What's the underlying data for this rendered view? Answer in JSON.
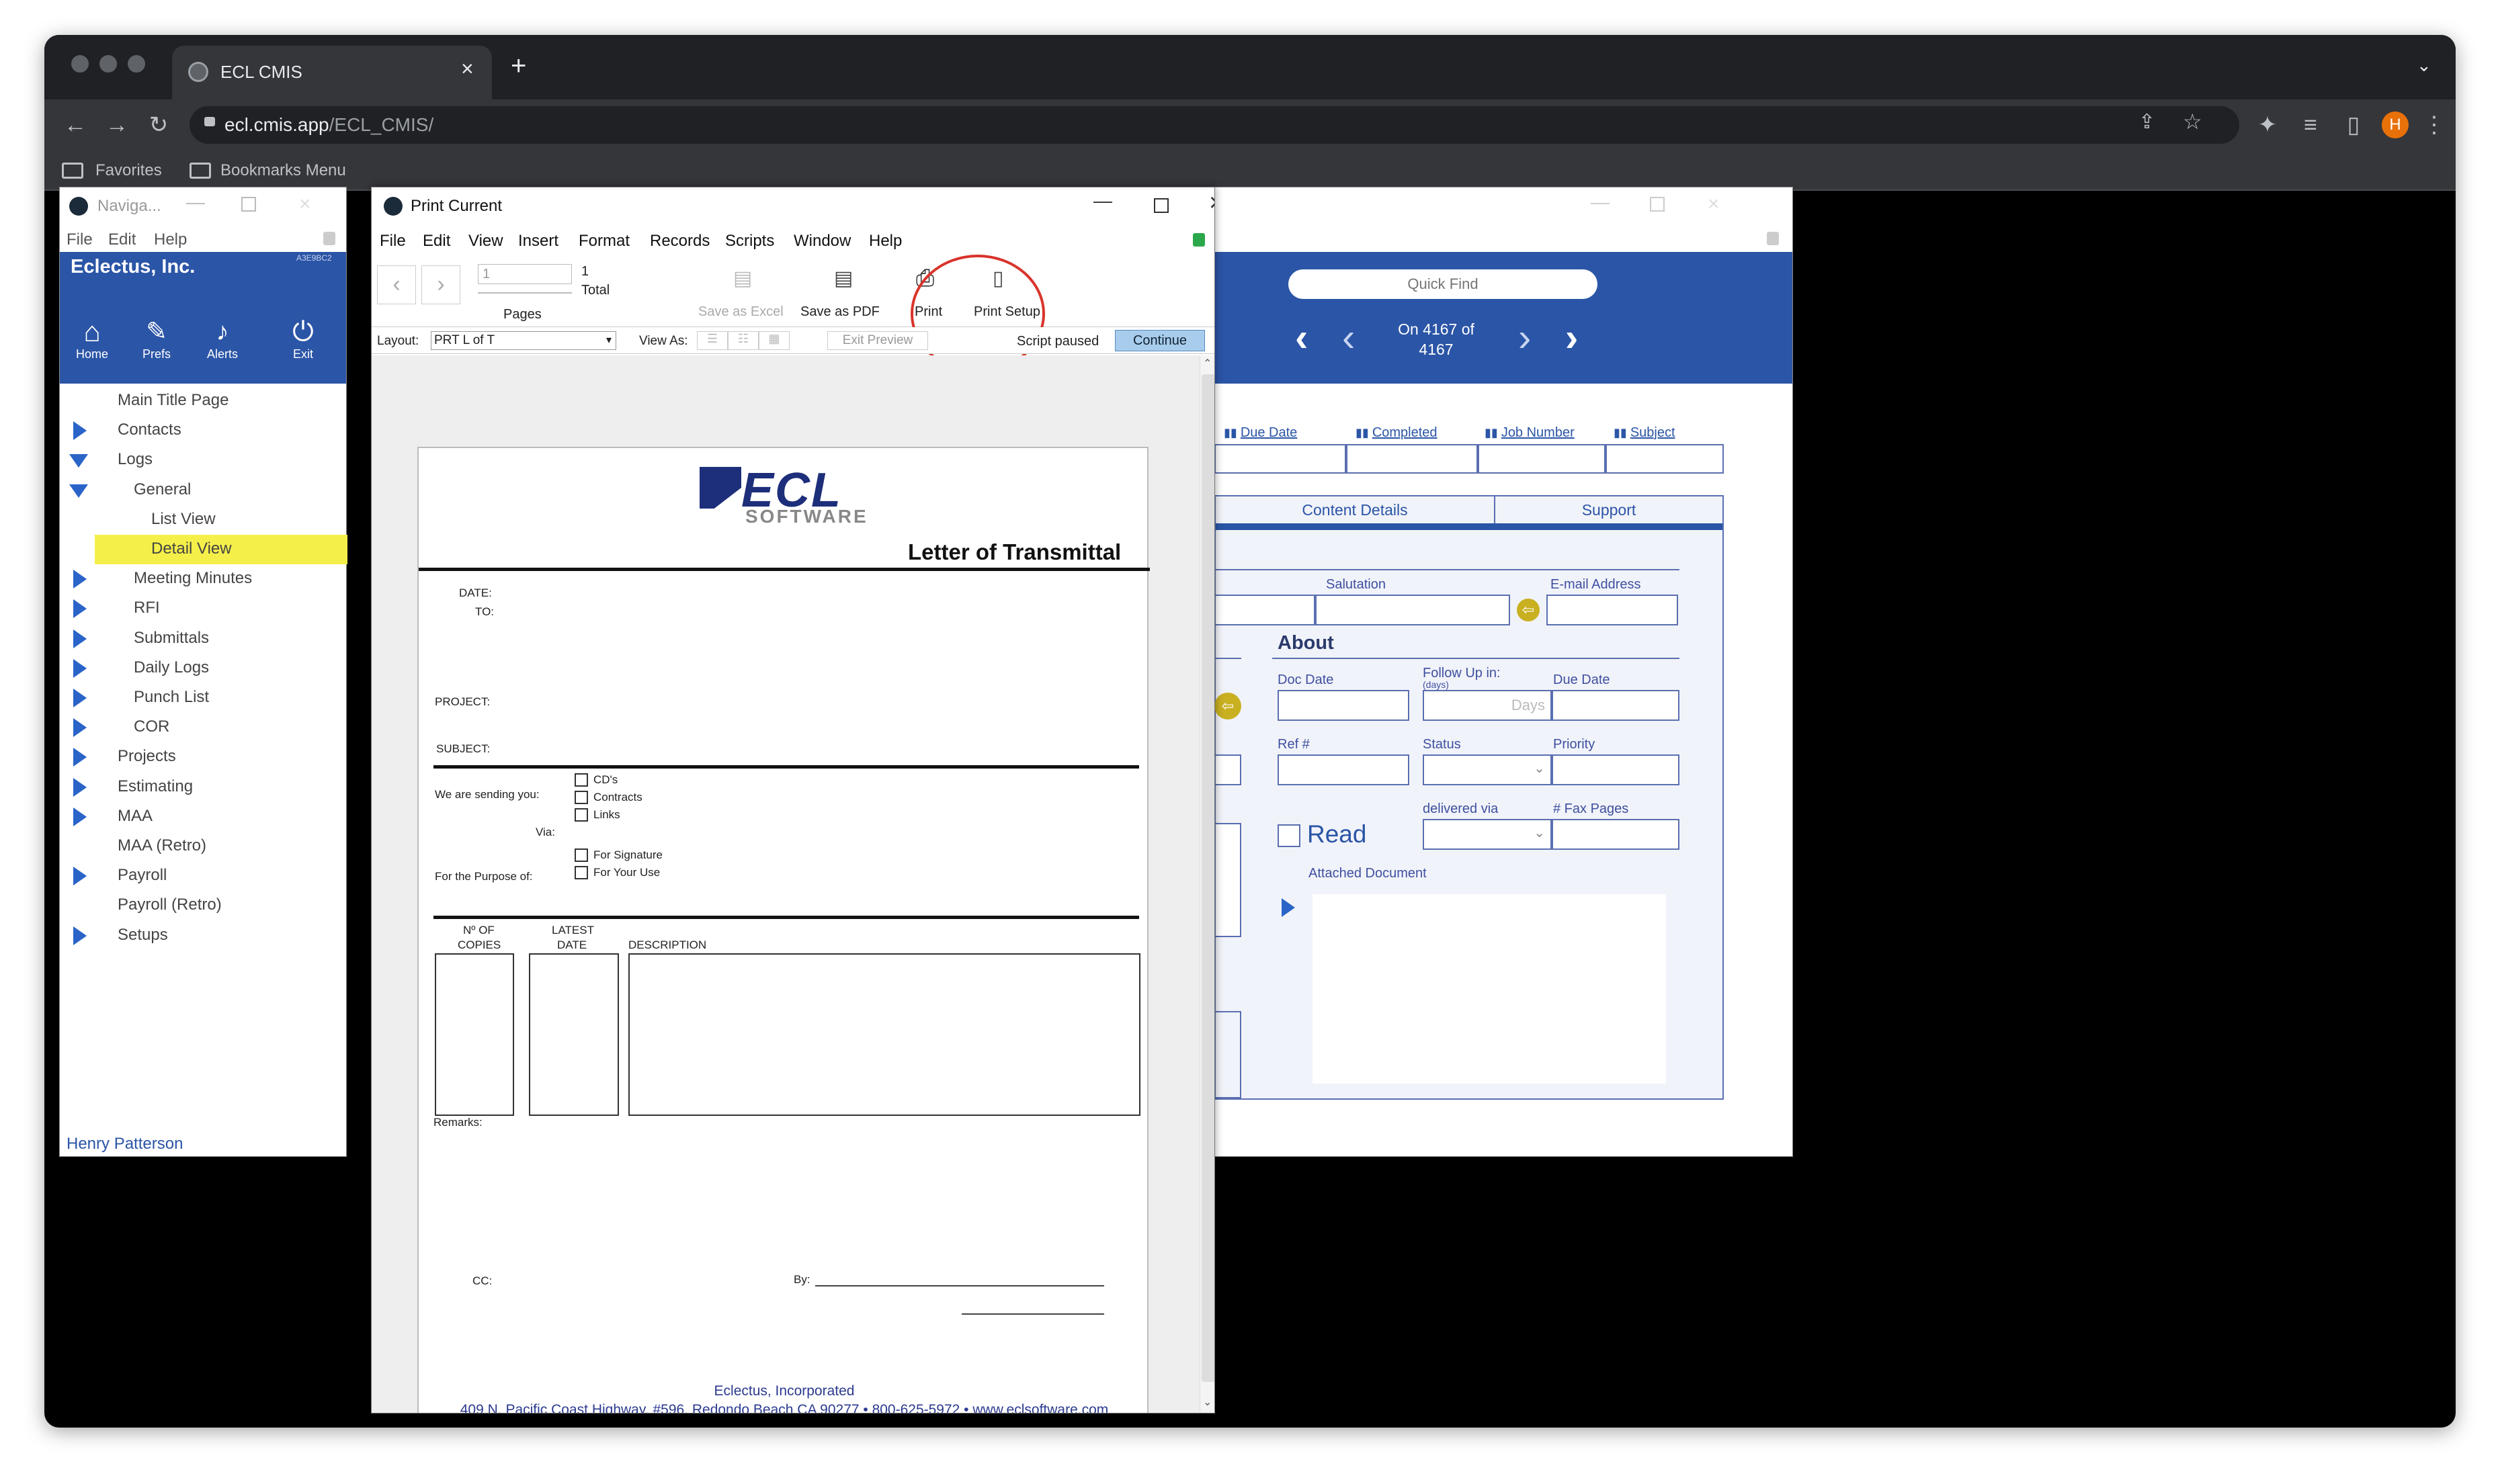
{
  "browser": {
    "tab_title": "ECL CMIS",
    "url_domain": "ecl.cmis.app",
    "url_path": "/ECL_CMIS/",
    "bookmarks": [
      "Favorites",
      "Bookmarks Menu"
    ],
    "profile_initial": "H"
  },
  "nav_window": {
    "title": "Naviga...",
    "menu": [
      "File",
      "Edit",
      "Help"
    ],
    "company": "Eclectus, Inc.",
    "code": "A3E9BC2",
    "toolbar": [
      {
        "label": "Home",
        "icon": "home-icon"
      },
      {
        "label": "Prefs",
        "icon": "prefs-icon"
      },
      {
        "label": "Alerts",
        "icon": "alerts-icon"
      },
      {
        "label": "Exit",
        "icon": "power-icon"
      }
    ],
    "items": [
      {
        "label": "Main Title Page",
        "arrow": "none",
        "indent": 0
      },
      {
        "label": "Contacts",
        "arrow": "right",
        "indent": 0
      },
      {
        "label": "Logs",
        "arrow": "down",
        "indent": 0
      },
      {
        "label": "General",
        "arrow": "down",
        "indent": 1
      },
      {
        "label": "List View",
        "arrow": "none",
        "indent": 2
      },
      {
        "label": "Detail View",
        "arrow": "none",
        "indent": 2,
        "selected": true
      },
      {
        "label": "Meeting Minutes",
        "arrow": "right",
        "indent": 1
      },
      {
        "label": "RFI",
        "arrow": "right",
        "indent": 1
      },
      {
        "label": "Submittals",
        "arrow": "right",
        "indent": 1
      },
      {
        "label": "Daily Logs",
        "arrow": "right",
        "indent": 1
      },
      {
        "label": "Punch List",
        "arrow": "right",
        "indent": 1
      },
      {
        "label": "COR",
        "arrow": "right",
        "indent": 1
      },
      {
        "label": "Projects",
        "arrow": "right",
        "indent": 0
      },
      {
        "label": "Estimating",
        "arrow": "right",
        "indent": 0
      },
      {
        "label": "MAA",
        "arrow": "right",
        "indent": 0
      },
      {
        "label": "MAA (Retro)",
        "arrow": "none",
        "indent": 0
      },
      {
        "label": "Payroll",
        "arrow": "right",
        "indent": 0
      },
      {
        "label": "Payroll (Retro)",
        "arrow": "none",
        "indent": 0
      },
      {
        "label": "Setups",
        "arrow": "right",
        "indent": 0
      }
    ],
    "user": "Henry Patterson"
  },
  "print_window": {
    "title": "Print Current",
    "menu": [
      "File",
      "Edit",
      "View",
      "Insert",
      "Format",
      "Records",
      "Scripts",
      "Window",
      "Help"
    ],
    "page_input": "1",
    "page_total": "1",
    "total_label": "Total",
    "pages_label": "Pages",
    "save_excel": "Save as Excel",
    "save_pdf": "Save as PDF",
    "print": "Print",
    "print_setup": "Print Setup",
    "layout_label": "Layout:",
    "layout_value": "PRT L of T",
    "view_as_label": "View As:",
    "exit_preview": "Exit Preview",
    "script_paused": "Script paused",
    "continue": "Continue",
    "annotation_color": "#d9342b"
  },
  "document": {
    "logo_top": "ECL",
    "logo_bottom": "SOFTWARE",
    "heading": "Letter of Transmittal",
    "date_label": "DATE:",
    "to_label": "TO:",
    "project_label": "PROJECT:",
    "subject_label": "SUBJECT:",
    "sending_label": "We are sending you:",
    "via_label": "Via:",
    "purpose_label": "For the Purpose of:",
    "items": [
      "CD's",
      "Contracts",
      "Links"
    ],
    "purpose_items": [
      "For Signature",
      "For Your Use"
    ],
    "col_copies": [
      "Nº OF",
      "COPIES"
    ],
    "col_date": [
      "LATEST",
      "DATE"
    ],
    "col_desc": "DESCRIPTION",
    "remarks_label": "Remarks:",
    "cc_label": "CC:",
    "by_label": "By:",
    "footer_company": "Eclectus, Incorporated",
    "footer_address": "409 N. Pacific Coast Highway, #596, Redondo Beach CA 90277 • 800-625-5972 • www.eclsoftware.com"
  },
  "detail_window": {
    "quick_find_placeholder": "Quick Find",
    "record_status": [
      "On 4167 of",
      "4167"
    ],
    "sort_columns": [
      "Due Date",
      "Completed",
      "Job Number",
      "Subject"
    ],
    "tabs": [
      "Content Details",
      "Support"
    ],
    "salutation_label": "Salutation",
    "email_label": "E-mail Address",
    "about_heading": "About",
    "doc_date_label": "Doc Date",
    "follow_up_label": "Follow Up in:",
    "follow_up_unit": "(days)",
    "days_placeholder": "Days",
    "due_date_label": "Due Date",
    "ref_label": "Ref #",
    "status_label": "Status",
    "priority_label": "Priority",
    "read_label": "Read",
    "delivered_label": "delivered via",
    "fax_label": "# Fax Pages",
    "attached_label": "Attached Document",
    "brand_blue": "#2b55a6"
  }
}
